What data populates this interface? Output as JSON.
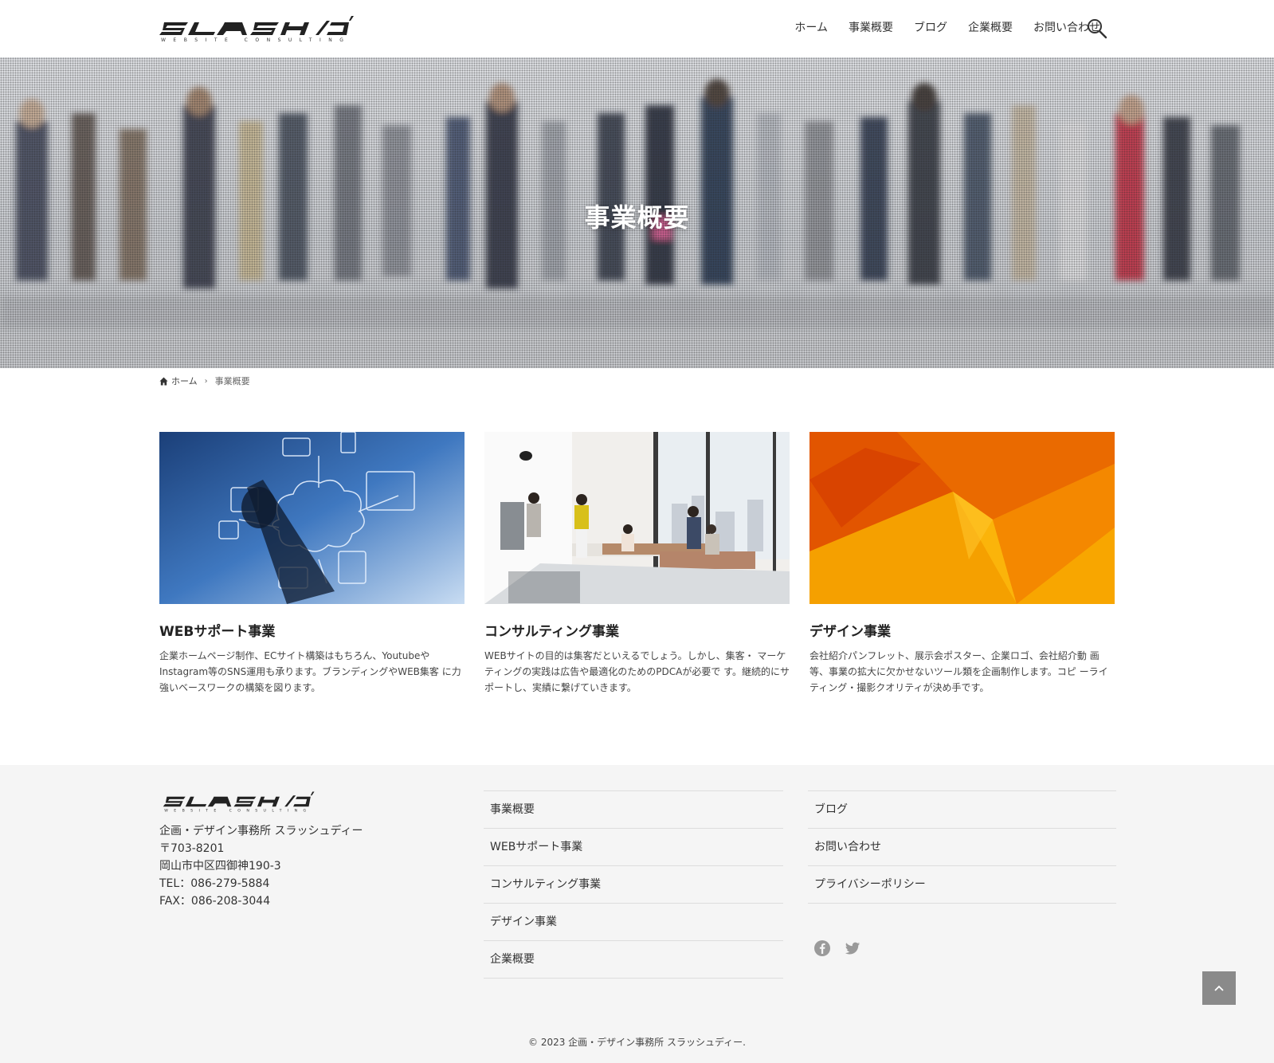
{
  "header": {
    "logo_main": "SLASH/D",
    "logo_sub": "WEBSITE CONSULTING",
    "nav": [
      "ホーム",
      "事業概要",
      "ブログ",
      "企業概要",
      "お問い合わせ"
    ],
    "search_icon": "search-icon"
  },
  "hero": {
    "title": "事業概要"
  },
  "breadcrumb": {
    "home": "ホーム",
    "current": "事業概要"
  },
  "cards": [
    {
      "title": "WEBサポート事業",
      "text": "企業ホームページ制作、ECサイト構築はもちろん、Youtubeや Instagram等のSNS運用も承ります。ブランディングやWEB集客 に力強いベースワークの構築を図ります。"
    },
    {
      "title": "コンサルティング事業",
      "text": "WEBサイトの目的は集客だといえるでしょう。しかし、集客・ マーケティングの実践は広告や最適化のためのPDCAが必要で す。継続的にサポートし、実績に繋げていきます。"
    },
    {
      "title": "デザイン事業",
      "text": "会社紹介パンフレット、展示会ポスター、企業ロゴ、会社紹介動 画等、事業の拡大に欠かせないツール類を企画制作します。コピ ーライティング・撮影クオリティが決め手です。"
    }
  ],
  "footer": {
    "address": [
      "企画・デザイン事務所 スラッシュディー",
      "〒703-8201",
      "岡山市中区四御神190-3",
      "TEL：086-279-5884",
      "FAX：086-208-3044"
    ],
    "menu_left": [
      "事業概要",
      "WEBサポート事業",
      "コンサルティング事業",
      "デザイン事業",
      "企業概要"
    ],
    "menu_right": [
      "ブログ",
      "お問い合わせ",
      "プライバシーポリシー"
    ],
    "social_icons": [
      "facebook-icon",
      "twitter-icon"
    ],
    "copyright": "© 2023 企画・デザイン事務所 スラッシュディー."
  },
  "colors": {
    "accent_orange": "#f07a00",
    "footer_bg": "#f5f5f5",
    "totop_bg": "#8a8a8a"
  }
}
